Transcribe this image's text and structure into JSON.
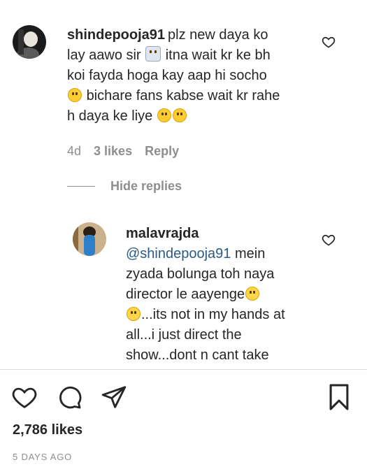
{
  "comment1": {
    "username": "shindepooja91",
    "text_1": "plz new daya ko",
    "text_2": "lay aawo sir",
    "text_3": "itna wait kr ke bh",
    "text_4": "koi fayda hoga kay aap hi socho",
    "text_5": "bichare fans kabse wait kr rahe",
    "text_6": "h daya ke liye",
    "time": "4d",
    "likes": "3 likes",
    "reply_label": "Reply"
  },
  "hide_replies_label": "Hide replies",
  "reply1": {
    "username": "malavrajda",
    "mention": "@shindepooja91",
    "text_1": "mein",
    "text_2": "zyada bolunga toh naya",
    "text_3": "director le aayenge",
    "text_4": "...its not in my hands at",
    "text_5": "all...i just direct the",
    "text_6": "show...dont n cant take"
  },
  "post": {
    "likes": "2,786 likes",
    "date": "5 DAYS AGO"
  },
  "icons": {
    "heart": "heart-icon",
    "comment": "comment-icon",
    "share": "share-icon",
    "bookmark": "bookmark-icon"
  }
}
